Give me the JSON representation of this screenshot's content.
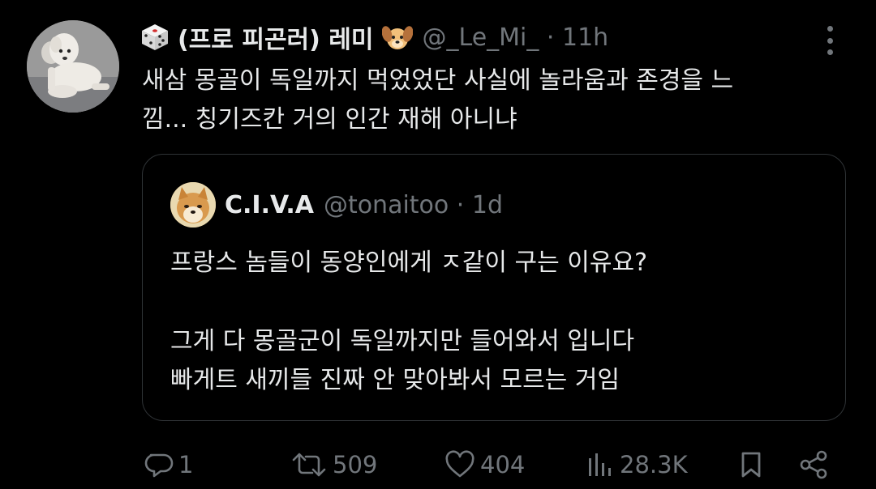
{
  "tweet": {
    "display_name": "(프로 피곤러) 레미",
    "handle_time": "@_Le_Mi_ · 11h",
    "lines": [
      "새삼 몽골이 독일까지 먹었었단 사실에 놀라움과 존경을 느",
      "낌... 칭기즈칸 거의 인간 재해 아니냐"
    ]
  },
  "quote": {
    "display_name": "C.I.V.A",
    "handle_time": "@tonaitoo · 1d",
    "lines": [
      "프랑스 놈들이 동양인에게 ㅈ같이 구는 이유요?",
      "그게 다 몽골군이 독일까지만 들어와서 입니다",
      "빠게트 새끼들 진짜 안 맞아봐서 모르는 거임"
    ]
  },
  "actions": {
    "reply_count": "1",
    "retweet_count": "509",
    "like_count": "404",
    "views_count": "28.3K"
  },
  "colors": {
    "background": "#000000",
    "text": "#e7e9ea",
    "muted": "#71767b",
    "border": "#2f3336"
  }
}
